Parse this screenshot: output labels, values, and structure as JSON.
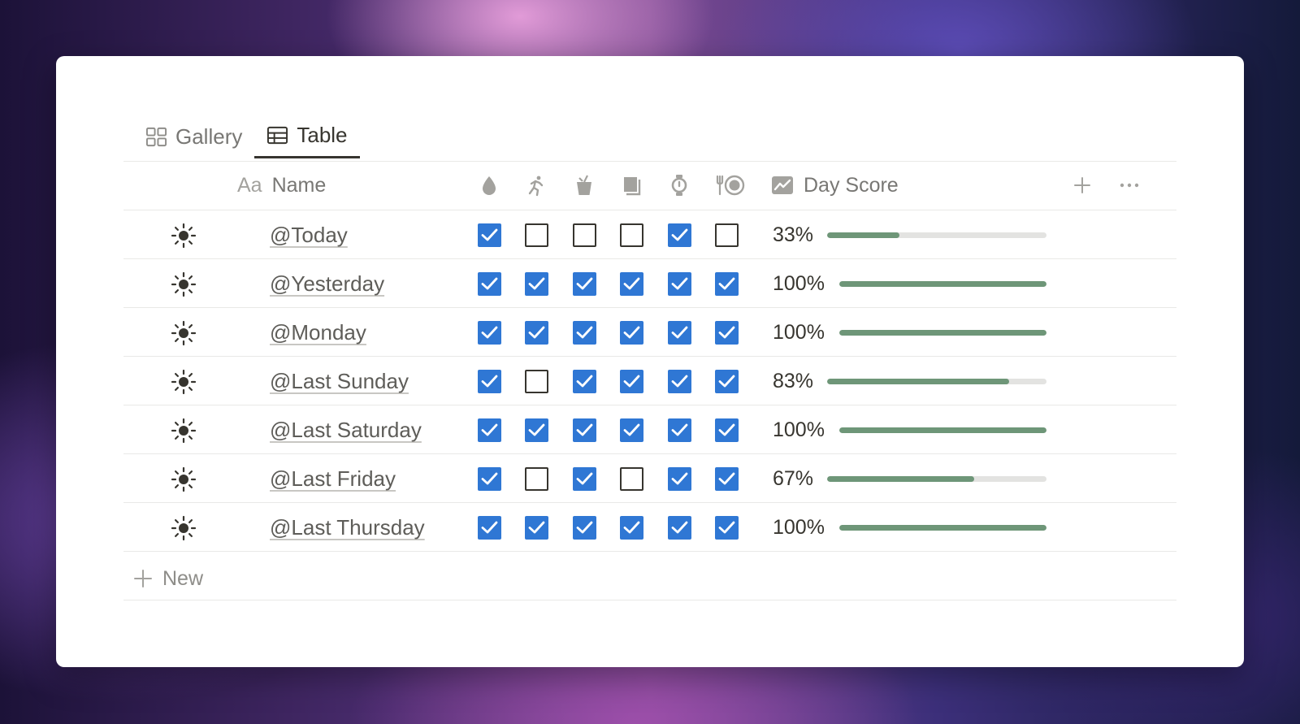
{
  "tabs": [
    {
      "label": "Gallery",
      "icon": "gallery-grid-icon",
      "active": false
    },
    {
      "label": "Table",
      "icon": "table-icon",
      "active": true
    }
  ],
  "columns": {
    "name_prefix": "Aa",
    "name_label": "Name",
    "habit_icons": [
      "water-drop-icon",
      "running-icon",
      "drink-cup-icon",
      "book-icon",
      "stopwatch-icon",
      "meal-icon"
    ],
    "score_label": "Day Score",
    "score_icon": "chart-icon"
  },
  "rows": [
    {
      "name": "@Today",
      "checks": [
        true,
        false,
        false,
        false,
        true,
        false
      ],
      "score_text": "33%",
      "score": 0.33
    },
    {
      "name": "@Yesterday",
      "checks": [
        true,
        true,
        true,
        true,
        true,
        true
      ],
      "score_text": "100%",
      "score": 1.0
    },
    {
      "name": "@Monday",
      "checks": [
        true,
        true,
        true,
        true,
        true,
        true
      ],
      "score_text": "100%",
      "score": 1.0
    },
    {
      "name": "@Last Sunday",
      "checks": [
        true,
        false,
        true,
        true,
        true,
        true
      ],
      "score_text": "83%",
      "score": 0.83
    },
    {
      "name": "@Last Saturday",
      "checks": [
        true,
        true,
        true,
        true,
        true,
        true
      ],
      "score_text": "100%",
      "score": 1.0
    },
    {
      "name": "@Last Friday",
      "checks": [
        true,
        false,
        true,
        false,
        true,
        true
      ],
      "score_text": "67%",
      "score": 0.67
    },
    {
      "name": "@Last Thursday",
      "checks": [
        true,
        true,
        true,
        true,
        true,
        true
      ],
      "score_text": "100%",
      "score": 1.0
    }
  ],
  "new_label": "New",
  "colors": {
    "checkbox_on": "#2f77d4",
    "progress_fill": "#6e9678",
    "progress_track": "#e3e3e1"
  }
}
